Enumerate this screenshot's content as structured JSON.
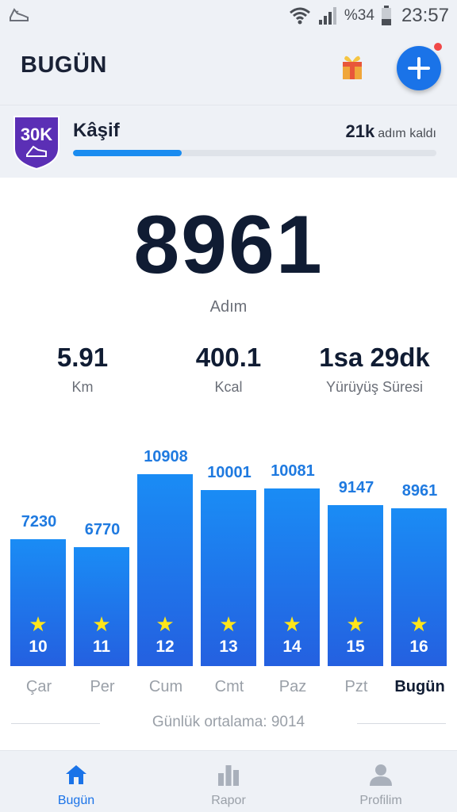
{
  "status_bar": {
    "battery_pct": "%34",
    "time": "23:57",
    "icons": [
      "shoe-icon",
      "wifi-icon",
      "signal-icon",
      "battery-icon"
    ]
  },
  "header": {
    "title": "BUGÜN",
    "icons": [
      "gift-icon",
      "plus-icon"
    ]
  },
  "goal": {
    "badge_text": "30K",
    "name": "Kâşif",
    "remaining_num": "21k",
    "remaining_text": "adım kaldı",
    "progress_fraction": 0.3
  },
  "today": {
    "steps": "8961",
    "steps_label": "Adım",
    "stats": [
      {
        "value": "5.91",
        "label": "Km"
      },
      {
        "value": "400.1",
        "label": "Kcal"
      },
      {
        "value": "1sa 29dk",
        "label": "Yürüyüş Süresi"
      }
    ]
  },
  "chart_data": {
    "type": "bar",
    "categories": [
      "Çar",
      "Per",
      "Cum",
      "Cmt",
      "Paz",
      "Pzt",
      "Bugün"
    ],
    "values": [
      7230,
      6770,
      10908,
      10001,
      10081,
      9147,
      8961
    ],
    "star_numbers": [
      "10",
      "11",
      "12",
      "13",
      "14",
      "15",
      "16"
    ],
    "highlight_category": "Bugün"
  },
  "average_text": "Günlük ortalama: 9014",
  "bottom_nav": {
    "items": [
      {
        "label": "Bugün",
        "icon": "home-icon",
        "active": true
      },
      {
        "label": "Rapor",
        "icon": "bar-chart-icon",
        "active": false
      },
      {
        "label": "Profilim",
        "icon": "person-icon",
        "active": false
      }
    ]
  },
  "colors": {
    "accent": "#1a73e8",
    "bar_top": "#1a8cf5",
    "bar_bottom": "#2460e0",
    "star": "#ffe51a",
    "badge": "#5b2fb5"
  }
}
